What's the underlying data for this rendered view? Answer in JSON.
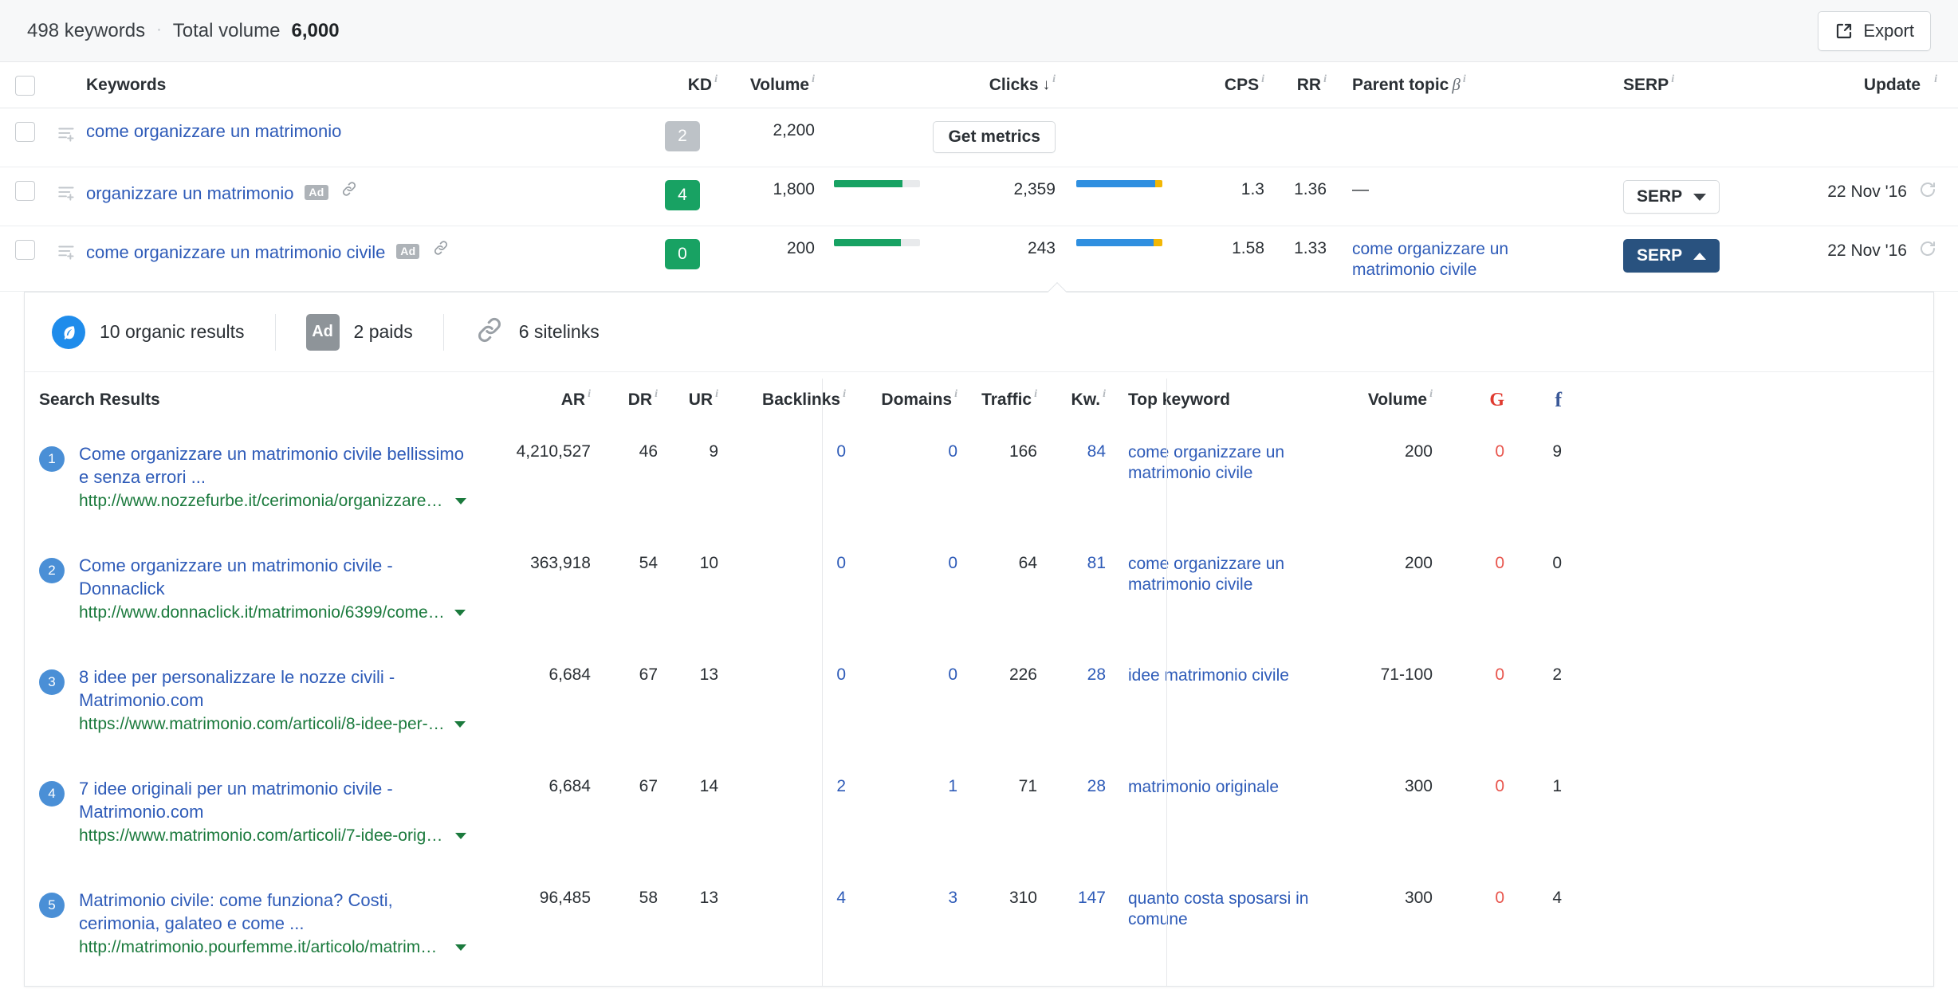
{
  "topbar": {
    "keyword_count": "498 keywords",
    "separator": "·",
    "total_volume_label": "Total volume",
    "total_volume_value": "6,000",
    "export_label": "Export"
  },
  "keyword_table": {
    "headers": {
      "keywords": "Keywords",
      "kd": "KD",
      "volume": "Volume",
      "clicks": "Clicks",
      "clicks_sort": "↓",
      "cps": "CPS",
      "rr": "RR",
      "parent_topic": "Parent topic",
      "parent_beta": "β",
      "serp": "SERP",
      "update": "Update",
      "info": "i"
    },
    "rows": [
      {
        "keyword": "come organizzare un matrimonio",
        "has_ad": false,
        "has_link": false,
        "kd": "2",
        "kd_style": "grey",
        "volume": "2,200",
        "volume_bar_pct": 0,
        "get_metrics_label": "Get metrics",
        "clicks": "",
        "clicks_bar_pct": 0,
        "cps": "",
        "rr": "",
        "parent_topic": "",
        "serp_label": "",
        "update": ""
      },
      {
        "keyword": "organizzare un matrimonio",
        "has_ad": true,
        "ad_label": "Ad",
        "has_link": true,
        "kd": "4",
        "kd_style": "green",
        "volume": "1,800",
        "volume_bar_pct": 80,
        "clicks": "2,359",
        "clicks_bar_pct": 92,
        "clicks_bar_gold_pct": 8,
        "cps": "1.3",
        "rr": "1.36",
        "parent_topic": "—",
        "serp_label": "SERP",
        "serp_active": false,
        "update": "22 Nov '16"
      },
      {
        "keyword": "come organizzare un matrimonio civile",
        "has_ad": true,
        "ad_label": "Ad",
        "has_link": true,
        "kd": "0",
        "kd_style": "green",
        "volume": "200",
        "volume_bar_pct": 78,
        "clicks": "243",
        "clicks_bar_pct": 90,
        "clicks_bar_gold_pct": 10,
        "cps": "1.58",
        "rr": "1.33",
        "parent_topic": "come organizzare un matrimonio civile",
        "serp_label": "SERP",
        "serp_active": true,
        "update": "22 Nov '16"
      }
    ]
  },
  "serp_panel": {
    "tabs": [
      {
        "icon": "leaf-icon",
        "label": "10 organic results"
      },
      {
        "icon": "ad-icon",
        "label": "2 paids",
        "badge": "Ad"
      },
      {
        "icon": "chain-icon",
        "label": "6 sitelinks"
      }
    ],
    "results_headers": {
      "search_results": "Search Results",
      "ar": "AR",
      "dr": "DR",
      "ur": "UR",
      "backlinks": "Backlinks",
      "domains": "Domains",
      "traffic": "Traffic",
      "kw": "Kw.",
      "top_keyword": "Top keyword",
      "volume": "Volume",
      "google": "G",
      "facebook": "f",
      "info": "i"
    },
    "results": [
      {
        "rank": "1",
        "title": "Come organizzare un matrimonio civile bellissimo e senza errori ...",
        "url": "http://www.nozzefurbe.it/cerimonia/organizzare-…",
        "ar": "4,210,527",
        "dr": "46",
        "ur": "9",
        "backlinks": "0",
        "domains": "0",
        "traffic": "166",
        "kw": "84",
        "top_keyword": "come organizzare un matrimonio civile",
        "volume": "200",
        "google": "0",
        "facebook": "9"
      },
      {
        "rank": "2",
        "title": "Come organizzare un matrimonio civile - Donnaclick",
        "url": "http://www.donnaclick.it/matrimonio/6399/come…",
        "ar": "363,918",
        "dr": "54",
        "ur": "10",
        "backlinks": "0",
        "domains": "0",
        "traffic": "64",
        "kw": "81",
        "top_keyword": "come organizzare un matrimonio civile",
        "volume": "200",
        "google": "0",
        "facebook": "0"
      },
      {
        "rank": "3",
        "title": "8 idee per personalizzare le nozze civili - Matrimonio.com",
        "url": "https://www.matrimonio.com/articoli/8-idee-per-…",
        "ar": "6,684",
        "dr": "67",
        "ur": "13",
        "backlinks": "0",
        "domains": "0",
        "traffic": "226",
        "kw": "28",
        "top_keyword": "idee matrimonio civile",
        "volume": "71-100",
        "google": "0",
        "facebook": "2"
      },
      {
        "rank": "4",
        "title": "7 idee originali per un matrimonio civile - Matrimonio.com",
        "url": "https://www.matrimonio.com/articoli/7-idee-origi…",
        "ar": "6,684",
        "dr": "67",
        "ur": "14",
        "backlinks": "2",
        "domains": "1",
        "traffic": "71",
        "kw": "28",
        "top_keyword": "matrimonio originale",
        "volume": "300",
        "google": "0",
        "facebook": "1"
      },
      {
        "rank": "5",
        "title": "Matrimonio civile: come funziona? Costi, cerimonia, galateo e come ...",
        "url": "http://matrimonio.pourfemme.it/articolo/matrimo…",
        "ar": "96,485",
        "dr": "58",
        "ur": "13",
        "backlinks": "4",
        "domains": "3",
        "traffic": "310",
        "kw": "147",
        "top_keyword": "quanto costa sposarsi in comune",
        "volume": "300",
        "google": "0",
        "facebook": "4"
      }
    ]
  },
  "colors": {
    "link_blue": "#2e5bb8",
    "green": "#18a263",
    "url_green": "#1b7a3d",
    "bar_blue": "#2f8fe0",
    "serp_active": "#29527f",
    "red": "#e8554d"
  }
}
